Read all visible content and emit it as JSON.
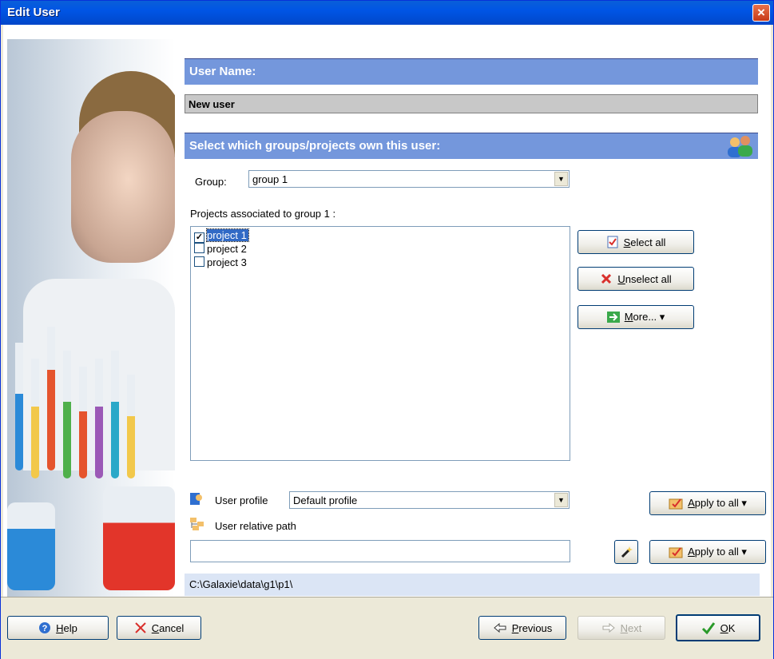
{
  "window": {
    "title": "Edit User",
    "close_glyph": "×"
  },
  "user_name": {
    "header": "User Name:",
    "value": "New user"
  },
  "groups_section": {
    "header": "Select which groups/projects own this user:",
    "group_label": "Group:",
    "group_value": "group 1",
    "projects_label": "Projects associated to group 1 :",
    "projects": [
      {
        "label": "project 1",
        "checked": true,
        "selected": true
      },
      {
        "label": "project 2",
        "checked": false,
        "selected": false
      },
      {
        "label": "project 3",
        "checked": false,
        "selected": false
      }
    ]
  },
  "side_buttons": {
    "select_all_prefix": "S",
    "select_all_rest": "elect all",
    "unselect_all_prefix": "U",
    "unselect_all_rest": "nselect all",
    "more_prefix": "M",
    "more_rest": "ore...",
    "dropdown_glyph": "▾"
  },
  "profile": {
    "user_profile_label": "User profile",
    "user_profile_value": "Default profile",
    "relative_path_label": "User relative path",
    "relative_path_value": "",
    "apply_prefix": "A",
    "apply_rest": "pply to all",
    "full_path": "C:\\Galaxie\\data\\g1\\p1\\"
  },
  "footer": {
    "help_prefix": "H",
    "help_rest": "elp",
    "cancel_prefix": "C",
    "cancel_rest": "ancel",
    "previous_prefix": "P",
    "previous_rest": "revious",
    "next_prefix": "N",
    "next_rest": "ext",
    "ok_prefix": "O",
    "ok_rest": "K"
  },
  "colors": {
    "header_bar": "#7497dc",
    "path_bar": "#dbe5f5",
    "titlebar": "#0055e5",
    "window_bg": "#ece9d8"
  }
}
